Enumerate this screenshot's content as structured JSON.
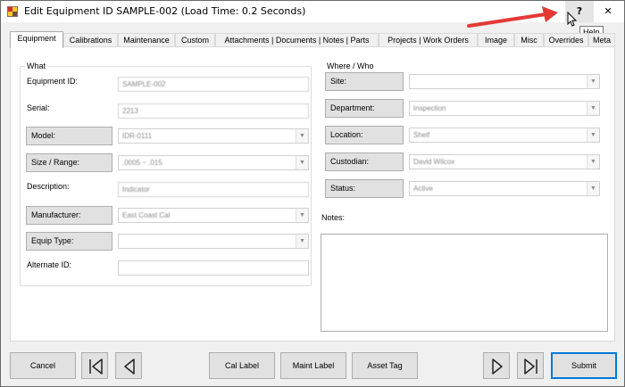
{
  "window": {
    "title": "Edit Equipment ID SAMPLE-002 (Load Time: 0.2 Seconds)",
    "help_label": "?",
    "close_label": "✕",
    "tooltip": "Help"
  },
  "tabs": [
    {
      "label": "Equipment",
      "active": true
    },
    {
      "label": "Calibrations"
    },
    {
      "label": "Maintenance"
    },
    {
      "label": "Custom"
    },
    {
      "label": "Attachments | Documents | Notes | Parts"
    },
    {
      "label": "Projects | Work Orders"
    },
    {
      "label": "Image"
    },
    {
      "label": "Misc"
    },
    {
      "label": "Overrides"
    },
    {
      "label": "Meta"
    }
  ],
  "what": {
    "title": "What",
    "equipment_id_label": "Equipment ID:",
    "equipment_id_value": "SAMPLE-002",
    "serial_label": "Serial:",
    "serial_value": "2213",
    "model_label": "Model:",
    "model_value": "IDR-0111",
    "size_label": "Size / Range:",
    "size_value": ".0005 ~ .015",
    "description_label": "Description:",
    "description_value": "Indicator",
    "manufacturer_label": "Manufacturer:",
    "manufacturer_value": "East Coast Cal",
    "equip_type_label": "Equip Type:",
    "equip_type_value": "",
    "alternate_id_label": "Alternate ID:",
    "alternate_id_value": ""
  },
  "where": {
    "title": "Where / Who",
    "site_label": "Site:",
    "site_value": "",
    "department_label": "Department:",
    "department_value": "Inspection",
    "location_label": "Location:",
    "location_value": "Shelf",
    "custodian_label": "Custodian:",
    "custodian_value": "David Wilcox",
    "status_label": "Status:",
    "status_value": "Active",
    "notes_label": "Notes:",
    "notes_value": ""
  },
  "bottom": {
    "cancel": "Cancel",
    "cal_label": "Cal Label",
    "maint_label": "Maint Label",
    "asset_tag": "Asset Tag",
    "submit": "Submit"
  },
  "icons": {
    "first": "first-record-icon",
    "previous": "previous-record-icon",
    "next": "next-record-icon",
    "last": "last-record-icon",
    "dropdown": "chevron-down-icon"
  },
  "colors": {
    "accent": "#0078d7",
    "arrow": "#e53935"
  }
}
